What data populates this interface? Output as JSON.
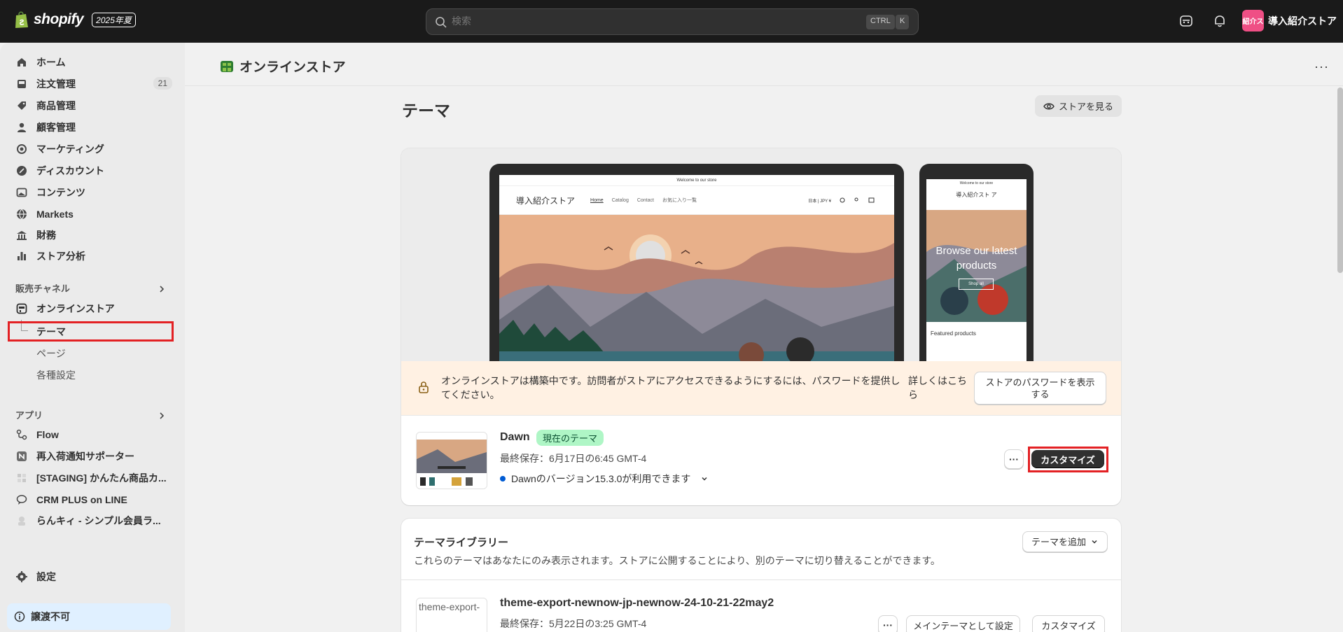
{
  "topbar": {
    "logo_text": "shopify",
    "edition_badge": "2025年夏",
    "search_placeholder": "検索",
    "shortcut_ctrl": "CTRL",
    "shortcut_k": "K",
    "avatar_text": "紹介ス",
    "store_name": "導入紹介ストア"
  },
  "sidebar": {
    "items": [
      {
        "label": "ホーム",
        "icon": "home-icon"
      },
      {
        "label": "注文管理",
        "icon": "inbox-icon",
        "badge": "21"
      },
      {
        "label": "商品管理",
        "icon": "tag-icon"
      },
      {
        "label": "顧客管理",
        "icon": "person-icon"
      },
      {
        "label": "マーケティング",
        "icon": "target-icon"
      },
      {
        "label": "ディスカウント",
        "icon": "discount-icon"
      },
      {
        "label": "コンテンツ",
        "icon": "image-icon"
      },
      {
        "label": "Markets",
        "icon": "globe-icon"
      },
      {
        "label": "財務",
        "icon": "bank-icon"
      },
      {
        "label": "ストア分析",
        "icon": "chart-bar-icon"
      }
    ],
    "sales_channels_label": "販売チャネル",
    "online_store": "オンラインストア",
    "sub_items": [
      "テーマ",
      "ページ",
      "各種設定"
    ],
    "apps_label": "アプリ",
    "apps": [
      "Flow",
      "再入荷通知サポーター",
      "[STAGING] かんたん商品カ...",
      "CRM PLUS on LINE",
      "らんキィ - シンプル会員ラ..."
    ],
    "settings": "設定",
    "transfer_notice": "譲渡不可"
  },
  "header": {
    "title": "オンラインストア",
    "more": "···"
  },
  "page": {
    "title": "テーマ",
    "view_store": "ストアを見る"
  },
  "preview": {
    "announcement": "Welcome to our store",
    "store_title": "導入紹介ストア",
    "nav": [
      "Home",
      "Catalog",
      "Contact",
      "お気に入り一覧"
    ],
    "locale": "日本 | JPY ¥",
    "phone_announcement": "Welcome to our store",
    "phone_store_title": "導入紹介スト ア",
    "phone_hero": "Browse our latest products",
    "phone_shop_all": "Shop all",
    "phone_featured": "Featured products"
  },
  "banner": {
    "text": "オンラインストアは構築中です。訪問者がストアにアクセスできるようにするには、パスワードを提供してください。",
    "learn_more": "詳しくはこちら",
    "show_password": "ストアのパスワードを表示する"
  },
  "current_theme": {
    "name": "Dawn",
    "badge": "現在のテーマ",
    "last_saved": "最終保存：6月17日の6:45 GMT-4",
    "update_notice": "Dawnのバージョン15.3.0が利用できます",
    "more": "···",
    "customize": "カスタマイズ"
  },
  "library": {
    "title": "テーマライブラリー",
    "description": "これらのテーマはあなたにのみ表示されます。ストアに公開することにより、別のテーマに切り替えることができます。",
    "add_theme": "テーマを追加",
    "themes": [
      {
        "thumb_alt": "theme-export-",
        "name": "theme-export-newnow-jp-newnow-24-10-21-22may2",
        "last_saved": "最終保存：5月22日の3:25 GMT-4",
        "more": "···",
        "publish": "メインテーマとして設定",
        "customize": "カスタマイズ"
      }
    ]
  },
  "colors": {
    "topbar": "#1a1a1a",
    "highlight": "#e32124",
    "badge_green": "#aff6c6",
    "banner": "#fff1e3"
  }
}
